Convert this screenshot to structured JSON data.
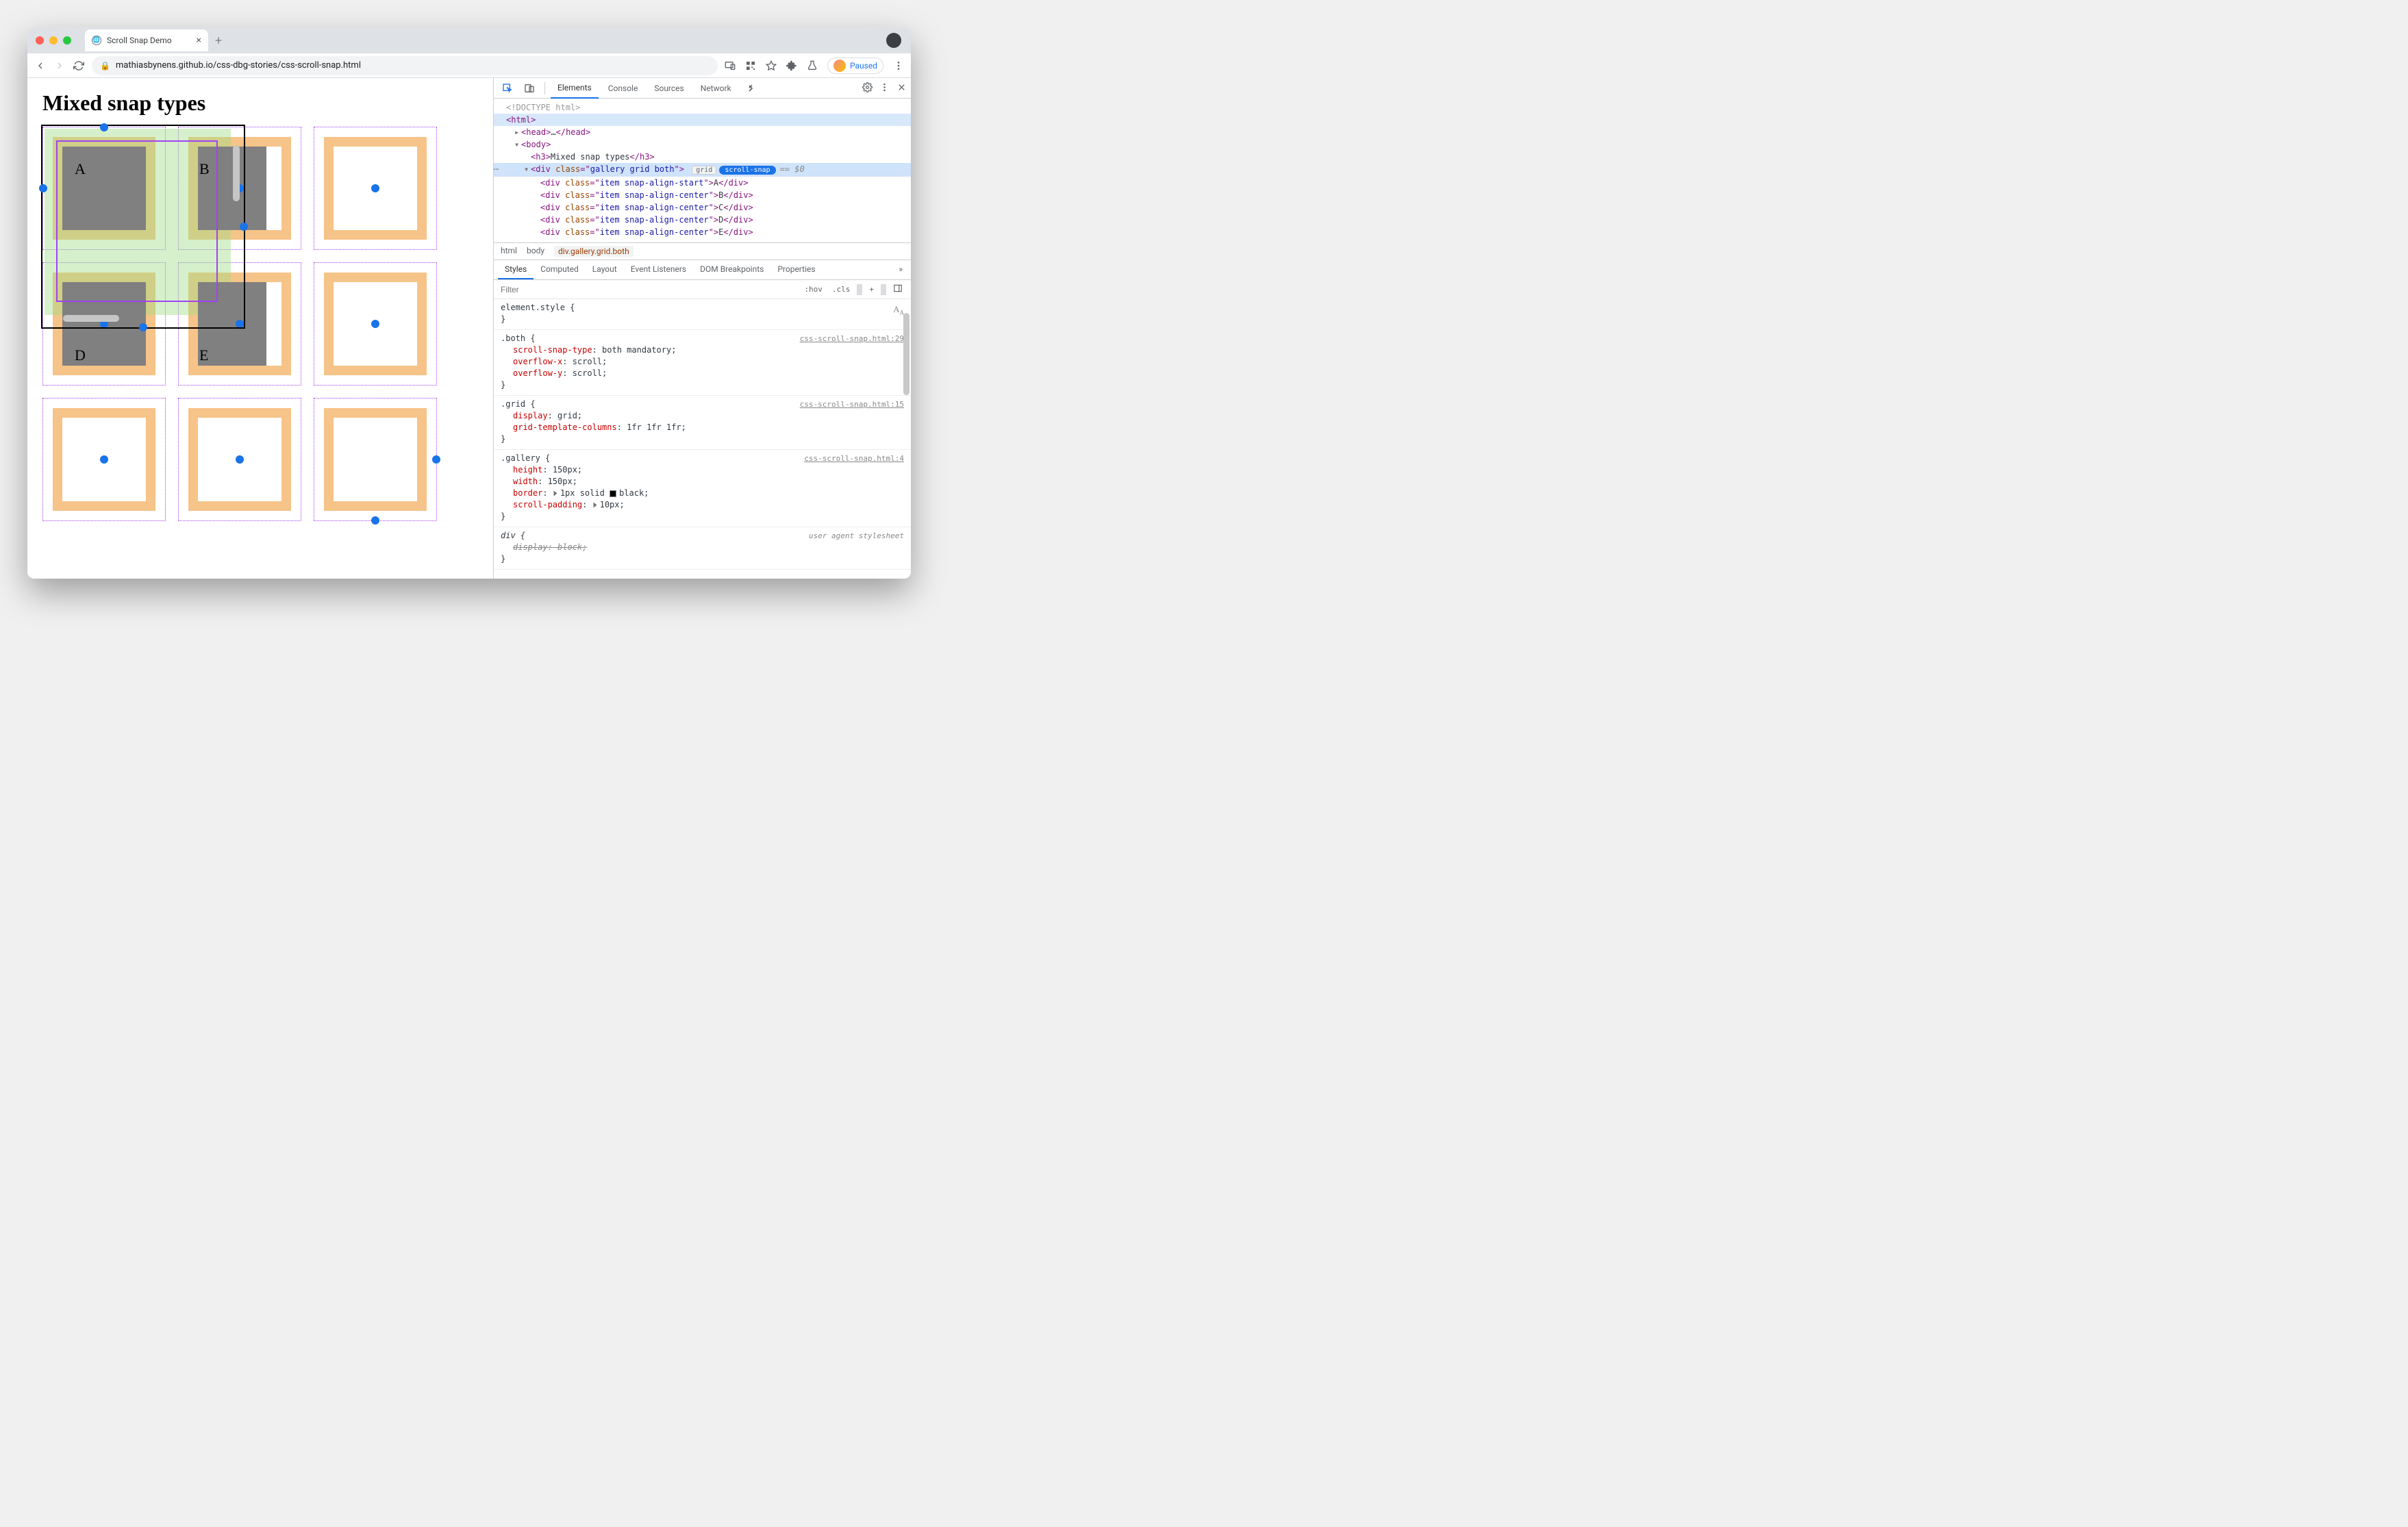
{
  "window": {
    "tab_title": "Scroll Snap Demo"
  },
  "addressbar": {
    "url": "mathiasbynens.github.io/css-dbg-stories/css-scroll-snap.html",
    "paused_label": "Paused"
  },
  "page": {
    "heading": "Mixed snap types",
    "items": [
      "A",
      "B",
      "D",
      "E"
    ]
  },
  "devtools": {
    "main_tabs": [
      "Elements",
      "Console",
      "Sources",
      "Network"
    ],
    "dom": {
      "doctype": "<!DOCTYPE html>",
      "html_open": "html",
      "head": "head",
      "body": "body",
      "h3_text": "Mixed snap types",
      "gallery_class": "gallery grid both",
      "badge_grid": "grid",
      "badge_snap": "scroll-snap",
      "eq0": "== $0",
      "items": [
        {
          "cls": "item snap-align-start",
          "txt": "A"
        },
        {
          "cls": "item snap-align-center",
          "txt": "B"
        },
        {
          "cls": "item snap-align-center",
          "txt": "C"
        },
        {
          "cls": "item snap-align-center",
          "txt": "D"
        },
        {
          "cls": "item snap-align-center",
          "txt": "E"
        }
      ]
    },
    "crumbs": [
      "html",
      "body",
      "div.gallery.grid.both"
    ],
    "sub_tabs": [
      "Styles",
      "Computed",
      "Layout",
      "Event Listeners",
      "DOM Breakpoints",
      "Properties"
    ],
    "filter_placeholder": "Filter",
    "filter_actions": [
      ":hov",
      ".cls",
      "+"
    ],
    "rules": [
      {
        "sel": "element.style {",
        "src": "",
        "decls": [],
        "close": "}"
      },
      {
        "sel": ".both {",
        "src": "css-scroll-snap.html:29",
        "decls": [
          {
            "p": "scroll-snap-type",
            "v": "both mandatory"
          },
          {
            "p": "overflow-x",
            "v": "scroll"
          },
          {
            "p": "overflow-y",
            "v": "scroll"
          }
        ],
        "close": "}"
      },
      {
        "sel": ".grid {",
        "src": "css-scroll-snap.html:15",
        "decls": [
          {
            "p": "display",
            "v": "grid"
          },
          {
            "p": "grid-template-columns",
            "v": "1fr 1fr 1fr"
          }
        ],
        "close": "}"
      },
      {
        "sel": ".gallery {",
        "src": "css-scroll-snap.html:4",
        "decls": [
          {
            "p": "height",
            "v": "150px"
          },
          {
            "p": "width",
            "v": "150px"
          },
          {
            "p": "border",
            "v": "1px solid ■ black",
            "tri": true,
            "swatch": true
          },
          {
            "p": "scroll-padding",
            "v": "10px",
            "tri": true
          }
        ],
        "close": "}"
      },
      {
        "sel": "div {",
        "src": "user agent stylesheet",
        "ua": true,
        "decls": [
          {
            "p": "display",
            "v": "block",
            "strike": true
          }
        ],
        "close": "}"
      }
    ]
  }
}
